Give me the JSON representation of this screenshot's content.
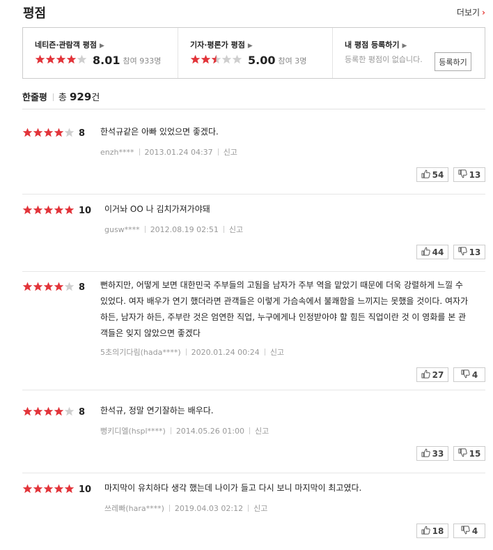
{
  "header": {
    "title": "평점",
    "more_label": "더보기"
  },
  "summary": {
    "netizen": {
      "title": "네티즌·관람객 평점",
      "rating_stars": 4,
      "score": "8.01",
      "participants": "참여 933명"
    },
    "critic": {
      "title": "기자·평론가 평점",
      "rating_stars": 2.5,
      "score": "5.00",
      "participants": "참여 3명"
    },
    "mine": {
      "title": "내 평점 등록하기",
      "text": "등록한 평점이 없습니다.",
      "button": "등록하기"
    }
  },
  "reviews_heading": {
    "label": "한줄평",
    "total_prefix": "총",
    "count": "929",
    "suffix": "건"
  },
  "reviews": [
    {
      "rating_stars": 4,
      "score": "8",
      "text": "한석규같은 아빠 있었으면 좋겠다.",
      "user": "enzh****",
      "date": "2013.01.24 04:37",
      "report": "신고",
      "likes": "54",
      "dislikes": "13"
    },
    {
      "rating_stars": 5,
      "score": "10",
      "text": "이거놔 OO 나 김치가져가야돼",
      "user": "gusw****",
      "date": "2012.08.19 02:51",
      "report": "신고",
      "likes": "44",
      "dislikes": "13"
    },
    {
      "rating_stars": 4,
      "score": "8",
      "text": "뻔하지만, 어떻게 보면 대한민국 주부들의 고됨을 남자가 주부 역을 맡았기 때문에 더욱 강렬하게 느낄 수 있었다. 여자 배우가 연기 했더라면 관객들은 이렇게 가슴속에서 불쾌함을 느끼지는 못했을 것이다. 여자가 하든, 남자가 하든, 주부란 것은 엄연한 직업, 누구에게나 인정받아야 할 힘든 직업이란 것 이 영화를 본 관객들은 잊지 않았으면 좋겠다",
      "user": "5초의기다림(hada****)",
      "date": "2020.01.24 00:24",
      "report": "신고",
      "likes": "27",
      "dislikes": "4"
    },
    {
      "rating_stars": 4,
      "score": "8",
      "text": "한석규, 정말 연기잘하는 배우다.",
      "user": "뻥키디엘(hspl****)",
      "date": "2014.05.26 01:00",
      "report": "신고",
      "likes": "33",
      "dislikes": "15"
    },
    {
      "rating_stars": 5,
      "score": "10",
      "text": "마지막이 유치하다 생각 했는데 나이가 들고 다시 보니 마지막이 최고였다.",
      "user": "쓰레빠(hara****)",
      "date": "2019.04.03 02:12",
      "report": "신고",
      "likes": "18",
      "dislikes": "4"
    }
  ],
  "colors": {
    "star_filled": "#e2343a",
    "star_empty": "#cfcfcf",
    "chevron": "#e53935"
  },
  "icons": {
    "star": "star-icon",
    "like": "thumbs-up-icon",
    "dislike": "thumbs-down-icon"
  }
}
